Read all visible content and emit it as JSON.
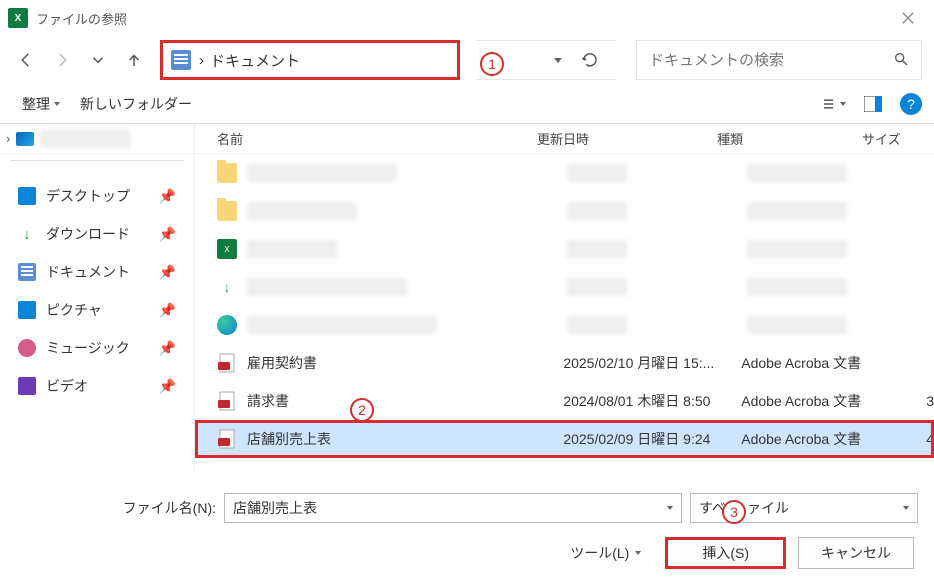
{
  "title": "ファイルの参照",
  "breadcrumb": {
    "sep": "›",
    "location": "ドキュメント"
  },
  "search": {
    "placeholder": "ドキュメントの検索"
  },
  "toolbar": {
    "organize": "整理",
    "newfolder": "新しいフォルダー"
  },
  "tree": {
    "desktop": "デスクトップ",
    "downloads": "ダウンロード",
    "documents": "ドキュメント",
    "pictures": "ピクチャ",
    "music": "ミュージック",
    "videos": "ビデオ"
  },
  "columns": {
    "name": "名前",
    "date": "更新日時",
    "type": "種類",
    "size": "サイズ"
  },
  "files": {
    "r6": {
      "name": "雇用契約書",
      "date": "2025/02/10 月曜日 15:...",
      "type": "Adobe Acroba 文書",
      "size": ""
    },
    "r7": {
      "name": "請求書",
      "date": "2024/08/01 木曜日 8:50",
      "type": "Adobe Acroba 文書",
      "size": "3"
    },
    "r8": {
      "name": "店舗別売上表",
      "date": "2025/02/09 日曜日 9:24",
      "type": "Adobe Acroba 文書",
      "size": "4"
    }
  },
  "footer": {
    "filename_label": "ファイル名(N):",
    "filename_value": "店舗別売上表",
    "filter_pre": "すべ",
    "filter_post": "ァイル",
    "tools": "ツール(L)",
    "insert": "挿入(S)",
    "cancel": "キャンセル"
  },
  "annot": {
    "a1": "1",
    "a2": "2",
    "a3": "3"
  }
}
